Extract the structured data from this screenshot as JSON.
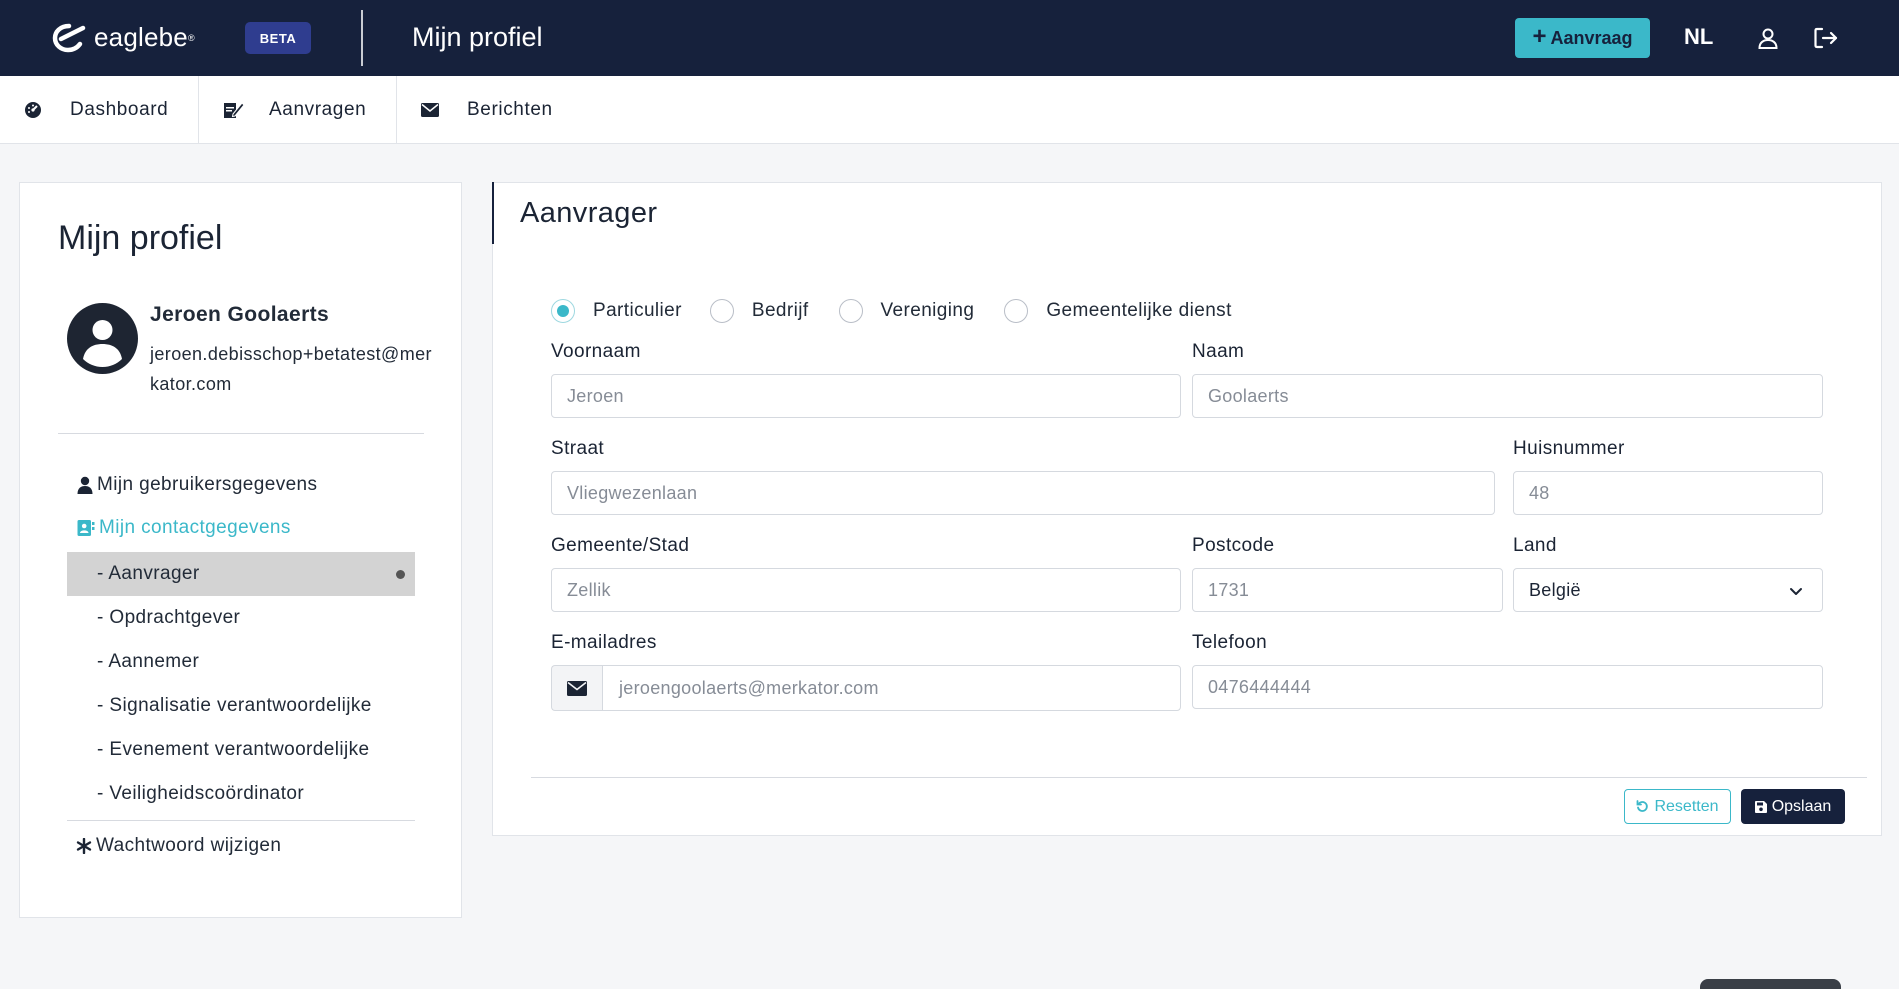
{
  "header": {
    "logo_text": "eaglebe",
    "logo_reg": "®",
    "beta_badge": "BETA",
    "page_title": "Mijn profiel",
    "new_request_label": "Aanvraag",
    "language": "NL",
    "icons": [
      "user-icon",
      "logout-icon"
    ]
  },
  "nav": {
    "tabs": [
      {
        "label": "Dashboard",
        "icon": "dashboard-icon"
      },
      {
        "label": "Aanvragen",
        "icon": "edit-icon"
      },
      {
        "label": "Berichten",
        "icon": "envelope-icon"
      }
    ]
  },
  "sidebar": {
    "title": "Mijn profiel",
    "user": {
      "name": "Jeroen Goolaerts",
      "email": "jeroen.debisschop+betatest@merkator.com"
    },
    "menu": {
      "user_data": "Mijn gebruikersgegevens",
      "contact_data": "Mijn contactgegevens",
      "sub_items": [
        "- Aanvrager",
        "- Opdrachtgever",
        "- Aannemer",
        "- Signalisatie verantwoordelijke",
        "- Evenement verantwoordelijke",
        "- Veiligheidscoördinator"
      ],
      "active_sub_index": 0,
      "password": "Wachtwoord wijzigen"
    }
  },
  "form": {
    "title": "Aanvrager",
    "type_options": [
      "Particulier",
      "Bedrijf",
      "Vereniging",
      "Gemeentelijke dienst"
    ],
    "selected_type": "Particulier",
    "fields": {
      "firstname": {
        "label": "Voornaam",
        "value": "Jeroen"
      },
      "lastname": {
        "label": "Naam",
        "value": "Goolaerts"
      },
      "street": {
        "label": "Straat",
        "value": "Vliegwezenlaan"
      },
      "housenumber": {
        "label": "Huisnummer",
        "value": "48"
      },
      "city": {
        "label": "Gemeente/Stad",
        "value": "Zellik"
      },
      "postcode": {
        "label": "Postcode",
        "value": "1731"
      },
      "country": {
        "label": "Land",
        "value": "België"
      },
      "email": {
        "label": "E-mailadres",
        "value": "jeroengoolaerts@merkator.com"
      },
      "phone": {
        "label": "Telefoon",
        "value": "0476444444"
      }
    },
    "reset_label": "Resetten",
    "save_label": "Opslaan"
  },
  "colors": {
    "header_bg": "#16213c",
    "accent": "#3bb8c9",
    "beta_bg": "#2f3d8f"
  }
}
